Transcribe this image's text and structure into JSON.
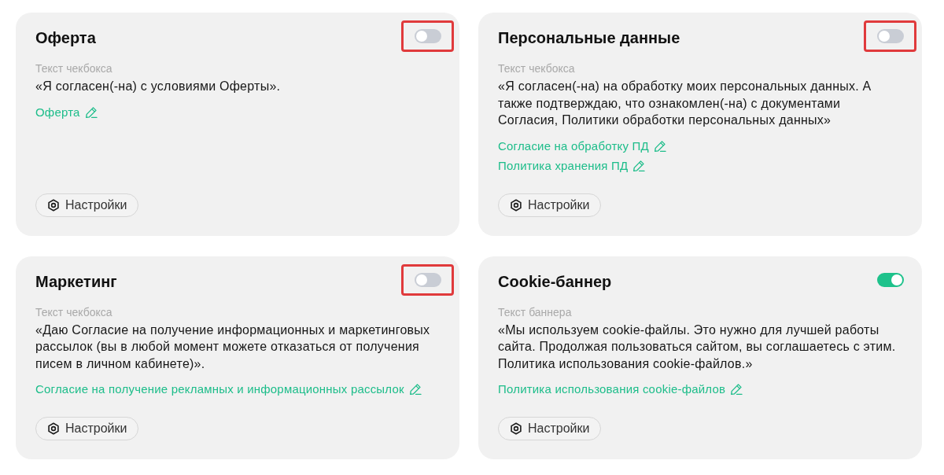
{
  "cards": [
    {
      "title": "Оферта",
      "enabled": false,
      "highlighted": true,
      "text_label": "Текст чекбокса",
      "text": "«Я согласен(-на) с условиями Оферты».",
      "links": [
        {
          "label": "Оферта"
        }
      ],
      "settings_button": "Настройки"
    },
    {
      "title": "Персональные данные",
      "enabled": false,
      "highlighted": true,
      "text_label": "Текст чекбокса",
      "text": "«Я согласен(-на) на обработку моих персональных данных. А также подтверждаю, что ознакомлен(-на) с документами Согласия, Политики обработки персональных данных»",
      "links": [
        {
          "label": "Согласие на обработку ПД"
        },
        {
          "label": "Политика хранения ПД"
        }
      ],
      "settings_button": "Настройки"
    },
    {
      "title": "Маркетинг",
      "enabled": false,
      "highlighted": true,
      "text_label": "Текст чекбокса",
      "text": "«Даю Согласие на получение информационных и маркетинговых рассылок (вы в любой момент можете отказаться от получения писем в личном кабинете)».",
      "links": [
        {
          "label": "Согласие на получение рекламных и информационных рассылок"
        }
      ],
      "settings_button": "Настройки"
    },
    {
      "title": "Cookie-баннер",
      "enabled": true,
      "highlighted": false,
      "text_label": "Текст баннера",
      "text": "«Мы используем cookie-файлы. Это нужно для лучшей работы сайта. Продолжая пользоваться сайтом, вы соглашаетесь с этим. Политика использования cookie-файлов.»",
      "links": [
        {
          "label": "Политика использования cookie-файлов"
        }
      ],
      "settings_button": "Настройки"
    }
  ]
}
